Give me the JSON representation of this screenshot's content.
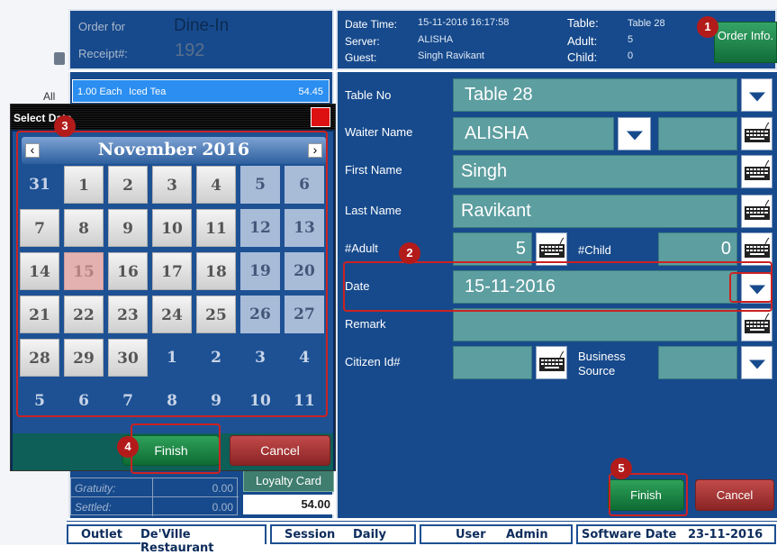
{
  "background_bits": {
    "top_text": "",
    "all_label": "All"
  },
  "order_header": {
    "order_for_label": "Order for",
    "order_for_value": "Dine-In",
    "receipt_label": "Receipt#:",
    "receipt_value": "192"
  },
  "order_item": {
    "qty_text": "1.00 Each",
    "name": "Iced Tea",
    "price": "54.45"
  },
  "totals": {
    "gratuity_label": "Gratuity:",
    "gratuity_value": "0.00",
    "settled_label": "Settled:",
    "settled_value": "0.00",
    "total_value": "54.00",
    "loyalty_label": "Loyalty Card"
  },
  "info_header": {
    "datetime_label": "Date Time:",
    "datetime_value": "15-11-2016 16:17:58",
    "server_label": "Server:",
    "server_value": "ALISHA",
    "guest_label": "Guest:",
    "guest_value": "Singh Ravikant",
    "table_label": "Table:",
    "table_value": "Table 28",
    "adult_label": "Adult:",
    "adult_value": "5",
    "child_label": "Child:",
    "child_value": "0",
    "order_info_label": "Order Info."
  },
  "form": {
    "table_no_label": "Table No",
    "table_no_value": "Table 28",
    "waiter_label": "Waiter Name",
    "waiter_value": "ALISHA",
    "first_name_label": "First Name",
    "first_name_value": "Singh",
    "last_name_label": "Last Name",
    "last_name_value": "Ravikant",
    "adult_label": "#Adult",
    "adult_value": "5",
    "child_label": "#Child",
    "child_value": "0",
    "date_label": "Date",
    "date_value": "15-11-2016",
    "remark_label": "Remark",
    "remark_value": "",
    "citizen_label": "Citizen Id#",
    "citizen_value": "",
    "business_label_1": "Business",
    "business_label_2": "Source",
    "finish_label": "Finish",
    "cancel_label": "Cancel"
  },
  "date_dialog": {
    "title": "Select Date",
    "month_label": "November 2016",
    "prev_glyph": "‹",
    "next_glyph": "›",
    "weeks": [
      [
        "31",
        "1",
        "2",
        "3",
        "4",
        "5",
        "6"
      ],
      [
        "7",
        "8",
        "9",
        "10",
        "11",
        "12",
        "13"
      ],
      [
        "14",
        "15",
        "16",
        "17",
        "18",
        "19",
        "20"
      ],
      [
        "21",
        "22",
        "23",
        "24",
        "25",
        "26",
        "27"
      ],
      [
        "28",
        "29",
        "30",
        "1",
        "2",
        "3",
        "4"
      ],
      [
        "5",
        "6",
        "7",
        "8",
        "9",
        "10",
        "11"
      ]
    ],
    "selected_day": "15",
    "finish_label": "Finish",
    "cancel_label": "Cancel"
  },
  "callouts": [
    "1",
    "2",
    "3",
    "4",
    "5"
  ],
  "status_bar": {
    "outlet_label": "Outlet",
    "outlet_value": "De'Ville Restaurant",
    "session_label": "Session",
    "session_value": "Daily",
    "user_label": "User",
    "user_value": "Admin",
    "software_date_label": "Software Date",
    "software_date_value": "23-11-2016"
  },
  "colors": {
    "panel_blue": "#174a8c",
    "field_teal": "#5d9ea0",
    "accent_red": "#b31b1b",
    "finish_green": "#1c8a47"
  }
}
